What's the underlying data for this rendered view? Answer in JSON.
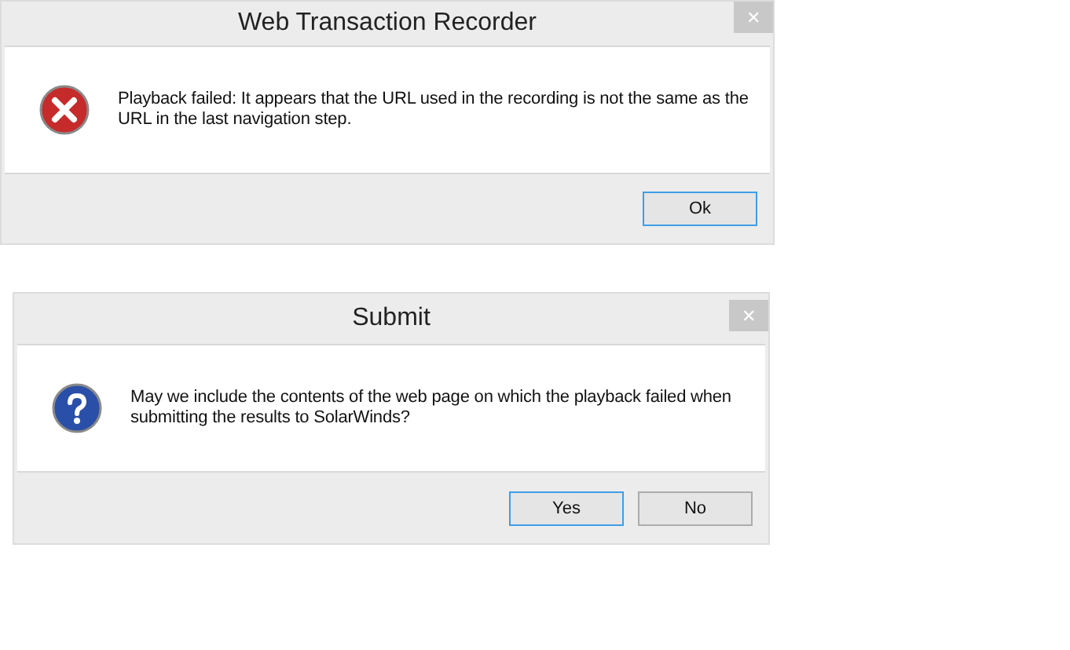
{
  "dialogs": [
    {
      "title": "Web Transaction Recorder",
      "close": "✕",
      "kind": "error",
      "message": "Playback failed: It appears that the URL used in the recording is not the same as the URL in the last navigation step.",
      "buttons": [
        {
          "label": "Ok",
          "default": true
        }
      ]
    },
    {
      "title": "Submit",
      "close": "✕",
      "kind": "question",
      "message": "May we include the contents of the web page on which the playback failed when submitting the results to SolarWinds?",
      "buttons": [
        {
          "label": "Yes",
          "default": true
        },
        {
          "label": "No",
          "default": false
        }
      ]
    }
  ]
}
